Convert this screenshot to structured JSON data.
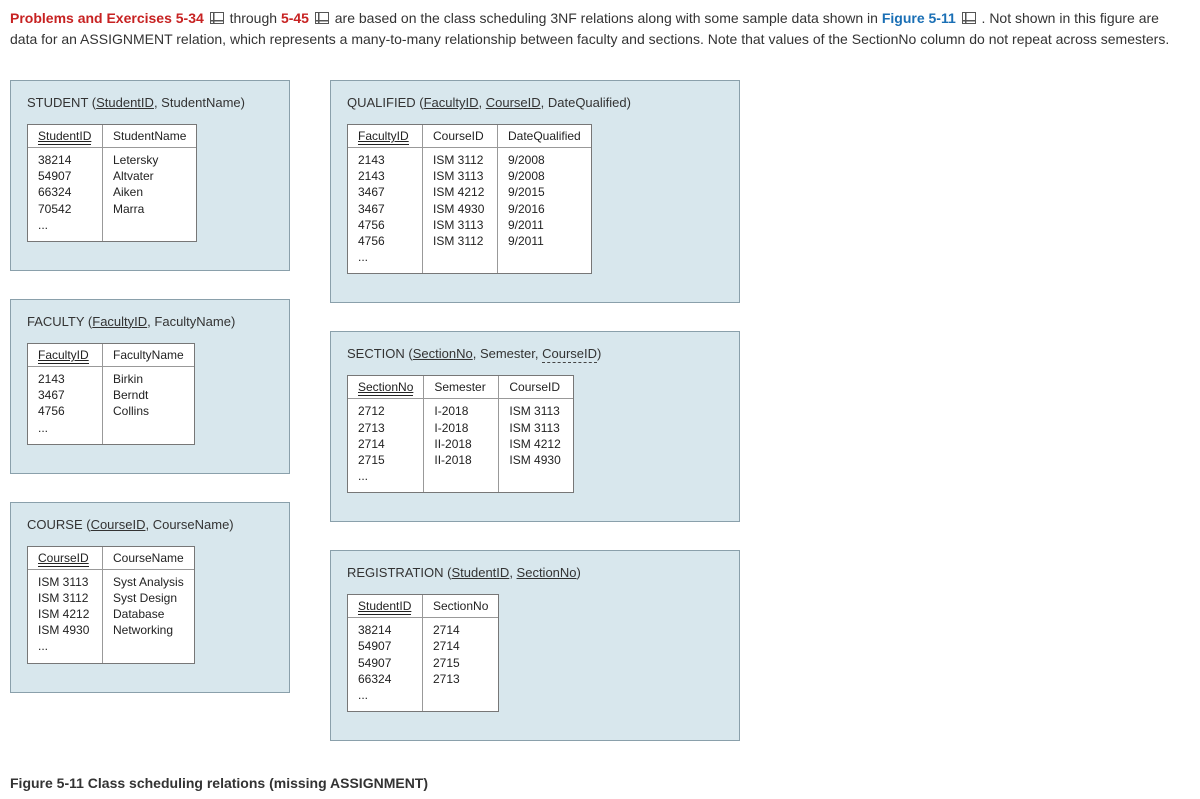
{
  "intro": {
    "p1a": "Problems and Exercises 5-34",
    "p1b": " through ",
    "p1c": "5-45",
    "p1d": " are based on the class scheduling 3NF relations along with some sample data shown in ",
    "p1e": "Figure 5-11",
    "p1f": ". Not shown in this figure are data for an ASSIGNMENT relation, which represents a many-to-many relationship between faculty and sections. Note that values of the SectionNo column do not repeat across semesters."
  },
  "caption": "Figure 5-11 Class scheduling relations (missing ASSIGNMENT)",
  "student": {
    "title_a": "STUDENT (",
    "title_pk": "StudentID",
    "title_b": ", StudentName)",
    "h1": "StudentID",
    "h2": "StudentName",
    "c1": [
      "38214",
      "54907",
      "66324",
      "70542",
      "..."
    ],
    "c2": [
      "Letersky",
      "Altvater",
      "Aiken",
      "Marra"
    ]
  },
  "faculty": {
    "title_a": "FACULTY (",
    "title_pk": "FacultyID",
    "title_b": ", FacultyName)",
    "h1": "FacultyID",
    "h2": "FacultyName",
    "c1": [
      "2143",
      "3467",
      "4756",
      "..."
    ],
    "c2": [
      "Birkin",
      "Berndt",
      "Collins"
    ]
  },
  "course": {
    "title_a": "COURSE (",
    "title_pk": "CourseID",
    "title_b": ", CourseName)",
    "h1": "CourseID",
    "h2": "CourseName",
    "c1": [
      "ISM 3113",
      "ISM 3112",
      "ISM 4212",
      "ISM 4930",
      "..."
    ],
    "c2": [
      "Syst Analysis",
      "Syst Design",
      "Database",
      "Networking"
    ]
  },
  "qualified": {
    "title_a": "QUALIFIED (",
    "title_pk1": "FacultyID",
    "title_m": ", ",
    "title_pk2": "CourseID",
    "title_b": ", DateQualified)",
    "h1": "FacultyID",
    "h2": "CourseID",
    "h3": "DateQualified",
    "c1": [
      "2143",
      "2143",
      "3467",
      "3467",
      "4756",
      "4756",
      "..."
    ],
    "c2": [
      "ISM 3112",
      "ISM 3113",
      "ISM 4212",
      "ISM 4930",
      "ISM 3113",
      "ISM 3112"
    ],
    "c3": [
      "9/2008",
      "9/2008",
      "9/2015",
      "9/2016",
      "9/2011",
      "9/2011"
    ]
  },
  "section": {
    "title_a": "SECTION (",
    "title_pk": "SectionNo",
    "title_m": ", Semester, ",
    "title_fk": "CourseID",
    "title_b": ")",
    "h1": "SectionNo",
    "h2": "Semester",
    "h3": "CourseID",
    "c1": [
      "2712",
      "2713",
      "2714",
      "2715",
      "..."
    ],
    "c2": [
      "I-2018",
      "I-2018",
      "II-2018",
      "II-2018"
    ],
    "c3": [
      "ISM 3113",
      "ISM 3113",
      "ISM 4212",
      "ISM 4930"
    ]
  },
  "registration": {
    "title_a": "REGISTRATION (",
    "title_pk1": "StudentID",
    "title_m": ", ",
    "title_pk2": "SectionNo",
    "title_b": ")",
    "h1": "StudentID",
    "h2": "SectionNo",
    "c1": [
      "38214",
      "54907",
      "54907",
      "66324",
      "..."
    ],
    "c2": [
      "2714",
      "2714",
      "2715",
      "2713"
    ]
  }
}
